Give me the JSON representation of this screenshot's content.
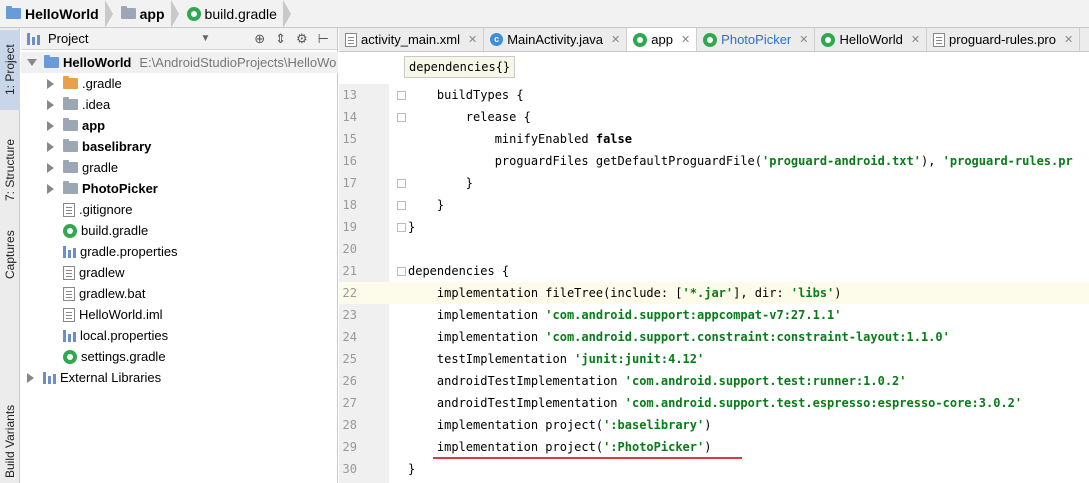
{
  "breadcrumb": [
    "HelloWorld",
    "app",
    "build.gradle"
  ],
  "left_tabs": [
    "1: Project",
    "7: Structure",
    "Captures",
    "Build Variants"
  ],
  "project_panel": {
    "title": "Project",
    "tools": [
      "⊕",
      "⇕",
      "⚙",
      "⊢"
    ],
    "tree": [
      {
        "name": "HelloWorld",
        "path": "E:\\AndroidStudioProjects\\HelloWo",
        "bold": true,
        "indent": 0,
        "arrow": "down",
        "icon": "folder-blue"
      },
      {
        "name": ".gradle",
        "bold": false,
        "indent": 1,
        "arrow": "right",
        "icon": "folder-orange"
      },
      {
        "name": ".idea",
        "bold": false,
        "indent": 1,
        "arrow": "right",
        "icon": "folder"
      },
      {
        "name": "app",
        "bold": true,
        "indent": 1,
        "arrow": "right",
        "icon": "folder-module"
      },
      {
        "name": "baselibrary",
        "bold": true,
        "indent": 1,
        "arrow": "right",
        "icon": "folder-module"
      },
      {
        "name": "gradle",
        "bold": false,
        "indent": 1,
        "arrow": "right",
        "icon": "folder"
      },
      {
        "name": "PhotoPicker",
        "bold": true,
        "indent": 1,
        "arrow": "right",
        "icon": "folder-module"
      },
      {
        "name": ".gitignore",
        "bold": false,
        "indent": 1,
        "arrow": "none",
        "icon": "file"
      },
      {
        "name": "build.gradle",
        "bold": false,
        "indent": 1,
        "arrow": "none",
        "icon": "gradle"
      },
      {
        "name": "gradle.properties",
        "bold": false,
        "indent": 1,
        "arrow": "none",
        "icon": "bars"
      },
      {
        "name": "gradlew",
        "bold": false,
        "indent": 1,
        "arrow": "none",
        "icon": "file"
      },
      {
        "name": "gradlew.bat",
        "bold": false,
        "indent": 1,
        "arrow": "none",
        "icon": "file"
      },
      {
        "name": "HelloWorld.iml",
        "bold": false,
        "indent": 1,
        "arrow": "none",
        "icon": "file"
      },
      {
        "name": "local.properties",
        "bold": false,
        "indent": 1,
        "arrow": "none",
        "icon": "bars"
      },
      {
        "name": "settings.gradle",
        "bold": false,
        "indent": 1,
        "arrow": "none",
        "icon": "gradle"
      },
      {
        "name": "External Libraries",
        "bold": false,
        "indent": 0,
        "arrow": "right",
        "icon": "bars"
      }
    ]
  },
  "editor_tabs": [
    {
      "label": "activity_main.xml",
      "icon": "file",
      "active": false,
      "blue": false
    },
    {
      "label": "MainActivity.java",
      "icon": "class",
      "active": false,
      "blue": false
    },
    {
      "label": "app",
      "icon": "gradle",
      "active": true,
      "blue": false
    },
    {
      "label": "PhotoPicker",
      "icon": "gradle",
      "active": false,
      "blue": true
    },
    {
      "label": "HelloWorld",
      "icon": "gradle",
      "active": false,
      "blue": false
    },
    {
      "label": "proguard-rules.pro",
      "icon": "file",
      "active": false,
      "blue": false
    }
  ],
  "hint": "dependencies{}",
  "code_lines": [
    {
      "n": "13",
      "parts": [
        {
          "t": "    buildTypes {"
        }
      ]
    },
    {
      "n": "14",
      "parts": [
        {
          "t": "        release {"
        }
      ]
    },
    {
      "n": "15",
      "parts": [
        {
          "t": "            minifyEnabled "
        },
        {
          "t": "false",
          "c": "kw"
        }
      ]
    },
    {
      "n": "16",
      "parts": [
        {
          "t": "            proguardFiles getDefaultProguardFile("
        },
        {
          "t": "'proguard-android.txt'",
          "c": "str"
        },
        {
          "t": "), "
        },
        {
          "t": "'proguard-rules.pr",
          "c": "str"
        }
      ]
    },
    {
      "n": "17",
      "parts": [
        {
          "t": "        }"
        }
      ]
    },
    {
      "n": "18",
      "parts": [
        {
          "t": "    }"
        }
      ]
    },
    {
      "n": "19",
      "parts": [
        {
          "t": "}"
        }
      ]
    },
    {
      "n": "20",
      "parts": [
        {
          "t": ""
        }
      ]
    },
    {
      "n": "21",
      "parts": [
        {
          "t": "dependencies {"
        }
      ]
    },
    {
      "n": "22",
      "parts": [
        {
          "t": "    implementation fileTree(include: ["
        },
        {
          "t": "'*.jar'",
          "c": "str"
        },
        {
          "t": "], dir: "
        },
        {
          "t": "'libs'",
          "c": "str"
        },
        {
          "t": ")"
        }
      ],
      "hl": true
    },
    {
      "n": "23",
      "parts": [
        {
          "t": "    implementation "
        },
        {
          "t": "'com.android.support:appcompat-v7:27.1.1'",
          "c": "str"
        }
      ]
    },
    {
      "n": "24",
      "parts": [
        {
          "t": "    implementation "
        },
        {
          "t": "'com.android.support.constraint:constraint-layout:1.1.0'",
          "c": "str"
        }
      ]
    },
    {
      "n": "25",
      "parts": [
        {
          "t": "    testImplementation "
        },
        {
          "t": "'junit:junit:4.12'",
          "c": "str"
        }
      ]
    },
    {
      "n": "26",
      "parts": [
        {
          "t": "    androidTestImplementation "
        },
        {
          "t": "'com.android.support.test:runner:1.0.2'",
          "c": "str"
        }
      ]
    },
    {
      "n": "27",
      "parts": [
        {
          "t": "    androidTestImplementation "
        },
        {
          "t": "'com.android.support.test.espresso:espresso-core:3.0.2'",
          "c": "str"
        }
      ]
    },
    {
      "n": "28",
      "parts": [
        {
          "t": "    implementation project("
        },
        {
          "t": "':baselibrary'",
          "c": "str"
        },
        {
          "t": ")"
        }
      ]
    },
    {
      "n": "29",
      "parts": [
        {
          "t": "    implementation project("
        },
        {
          "t": "':PhotoPicker'",
          "c": "str"
        },
        {
          "t": ")"
        }
      ]
    },
    {
      "n": "30",
      "parts": [
        {
          "t": "}"
        }
      ]
    }
  ]
}
